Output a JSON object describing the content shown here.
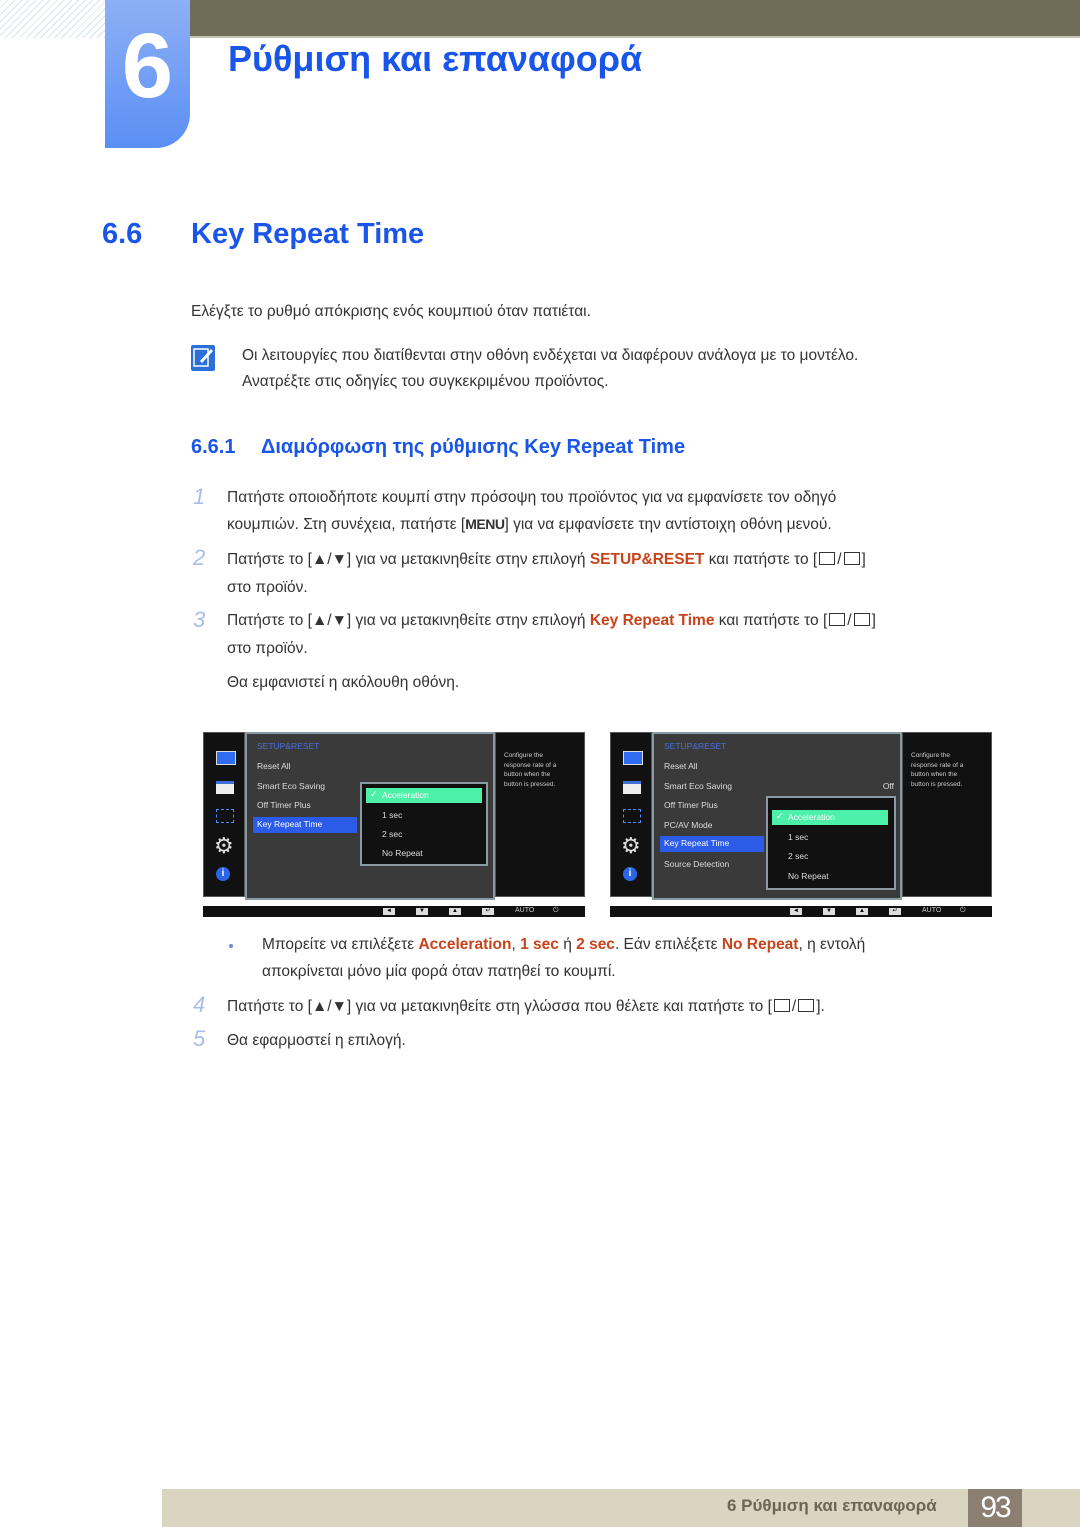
{
  "chapter": {
    "number": "6",
    "title": "Ρύθμιση και επαναφορά"
  },
  "section": {
    "number": "6.6",
    "title": "Key Repeat Time"
  },
  "intro": "Ελέγξτε το ρυθμό απόκρισης ενός κουμπιού όταν πατιέται.",
  "note": {
    "icon": "note-pencil-icon",
    "line1": "Οι λειτουργίες που διατίθενται στην οθόνη ενδέχεται να διαφέρουν ανάλογα με το μοντέλο.",
    "line2": "Ανατρέξτε στις οδηγίες του συγκεκριμένου προϊόντος."
  },
  "subsection": {
    "number": "6.6.1",
    "title": "Διαμόρφωση της ρύθμισης Key Repeat Time"
  },
  "steps": {
    "s1": {
      "num": "1",
      "line1": "Πατήστε οποιοδήποτε κουμπί στην πρόσοψη του προϊόντος για να εμφανίσετε τον οδηγό",
      "line2a": "κουμπιών. Στη συνέχεια, πατήστε [",
      "menu_key": "MENU",
      "line2b": "] για να εμφανίσετε την αντίστοιχη οθόνη μενού."
    },
    "s2": {
      "num": "2",
      "a": "Πατήστε το [▲/▼] για να μετακινηθείτε στην επιλογή ",
      "hl": "SETUP&RESET",
      "b": " και πατήστε το [",
      "c": "]",
      "line2": "στο προϊόν."
    },
    "s3": {
      "num": "3",
      "a": "Πατήστε το [▲/▼] για να μετακινηθείτε στην επιλογή ",
      "hl": "Key Repeat Time",
      "b": " και πατήστε το [",
      "c": "]",
      "line2": "στο προϊόν.",
      "line3": "Θα εμφανιστεί η ακόλουθη οθόνη."
    },
    "bullet": {
      "a": "Μπορείτε να επιλέξετε ",
      "h1": "Acceleration",
      "b": ", ",
      "h2": "1 sec",
      "c": " ή ",
      "h3": "2 sec",
      "d": ". Εάν επιλέξετε ",
      "h4": "No Repeat",
      "e": ", η εντολή",
      "line2": "αποκρίνεται μόνο μία φορά όταν πατηθεί το κουμπί."
    },
    "s4": {
      "num": "4",
      "a": "Πατήστε το [▲/▼] για να μετακινηθείτε στη γλώσσα που θέλετε και πατήστε το [",
      "b": "]."
    },
    "s5": {
      "num": "5",
      "text": "Θα εφαρμοστεί η επιλογή."
    }
  },
  "osd_common": {
    "title": "SETUP&RESET",
    "description": [
      "Configure the",
      "response rate of a",
      "button when the",
      "button is pressed."
    ],
    "options": [
      "Acceleration",
      "1 sec",
      "2 sec",
      "No Repeat"
    ],
    "selected_option": "Acceleration",
    "check": "✓",
    "bottom_buttons": [
      "◄",
      "▼",
      "▲",
      "↵"
    ],
    "auto_label": "AUTO",
    "power": "⏻"
  },
  "osd1": {
    "items": [
      "Reset All",
      "Smart Eco Saving",
      "Off Timer Plus",
      "Key Repeat Time"
    ],
    "selected": "Key Repeat Time"
  },
  "osd2": {
    "items": [
      "Reset All",
      "Smart Eco Saving",
      "Off Timer Plus",
      "PC/AV Mode",
      "Key Repeat Time",
      "Source Detection"
    ],
    "selected": "Key Repeat Time",
    "smart_eco_value": "Off"
  },
  "footer": {
    "text": "6 Ρύθμιση και επαναφορά",
    "page": "93"
  }
}
